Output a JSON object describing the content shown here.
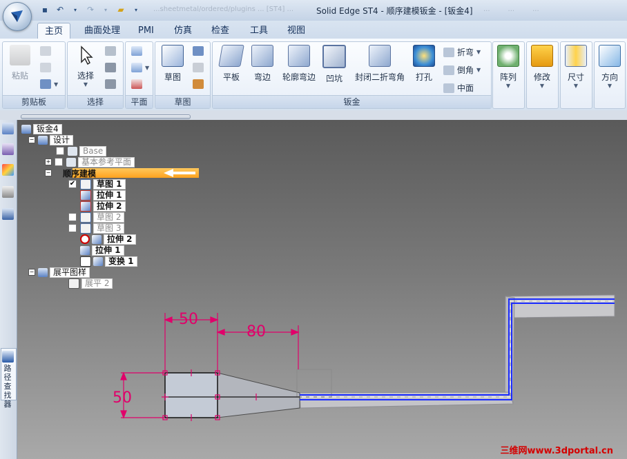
{
  "window": {
    "title": "Solid Edge ST4 - 顺序建模钣金 - [钣金4]",
    "faded_left": "...sheetmetal/ordered/plugins ... [ST4] ...",
    "faded_right": [
      "...",
      "...",
      "..."
    ]
  },
  "tabs": [
    "主页",
    "曲面处理",
    "PMI",
    "仿真",
    "检查",
    "工具",
    "视图"
  ],
  "ribbon": {
    "clipboard": {
      "label": "剪贴板",
      "paste": "粘贴"
    },
    "select": {
      "label": "选择",
      "select": "选择"
    },
    "plane": {
      "label": "平面"
    },
    "sketch": {
      "label": "草图",
      "sketch": "草图"
    },
    "sheetmetal": {
      "label": "钣金",
      "tab": "平板",
      "flange": "弯边",
      "contour_flange": "轮廓弯边",
      "dimple": "凹坑",
      "closed_corner": "封闭二折弯角",
      "hole": "打孔",
      "fold": "折弯",
      "chamfer": "倒角",
      "midplane": "中面"
    },
    "pattern": "阵列",
    "modify": "修改",
    "dimension": "尺寸",
    "orient": "方向"
  },
  "left_panel": {
    "vertical_label": "路径查找器"
  },
  "tree": {
    "root": "钣金4",
    "design": "设计",
    "base": "Base",
    "ref_planes": "基本参考平面",
    "ordered": "顺序建模",
    "items": [
      "草图 1",
      "拉伸 1",
      "拉伸 2",
      "草图 2",
      "草图 3",
      "拉伸 2",
      "拉伸 1",
      "变换 1"
    ],
    "flat_pattern": "展平图样",
    "flatten": "展平 2"
  },
  "dimensions": {
    "width": "50",
    "offset": "80",
    "height": "50"
  },
  "watermark": "三维网www.3dportal.cn",
  "colors": {
    "dimension": "#e0006a",
    "highlight_edge": "#1a2bff",
    "ordered_bar": "#ffa21f"
  }
}
